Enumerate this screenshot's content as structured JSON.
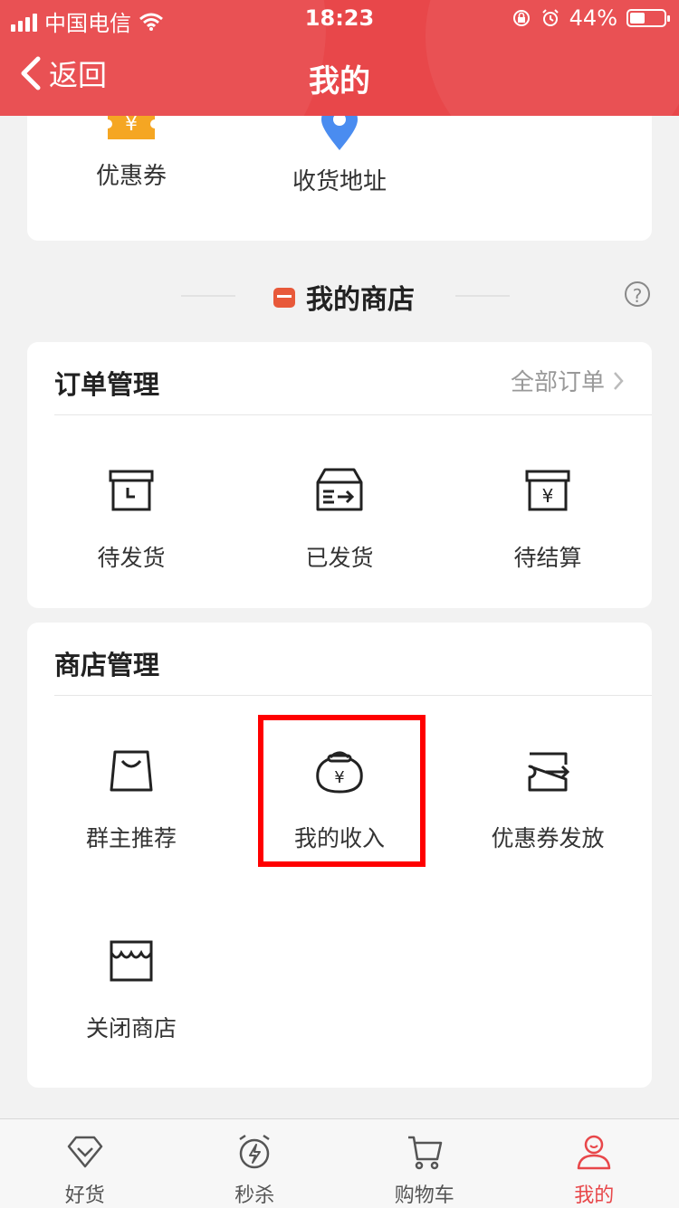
{
  "status": {
    "carrier": "中国电信",
    "time": "18:23",
    "battery": "44%"
  },
  "nav": {
    "back_label": "返回",
    "title": "我的"
  },
  "quick": [
    {
      "label": "优惠券",
      "icon": "coupon-icon"
    },
    {
      "label": "收货地址",
      "icon": "location-pin-icon"
    }
  ],
  "store_section": {
    "title": "我的商店"
  },
  "orders": {
    "title": "订单管理",
    "all_link": "全部订单",
    "items": [
      {
        "label": "待发货",
        "icon": "pending-ship-box-icon"
      },
      {
        "label": "已发货",
        "icon": "shipped-box-icon"
      },
      {
        "label": "待结算",
        "icon": "pending-settle-box-icon"
      }
    ]
  },
  "shop": {
    "title": "商店管理",
    "items": [
      {
        "label": "群主推荐",
        "icon": "shopping-bag-icon"
      },
      {
        "label": "我的收入",
        "icon": "money-bag-icon"
      },
      {
        "label": "优惠券发放",
        "icon": "coupon-send-icon"
      },
      {
        "label": "关闭商店",
        "icon": "storefront-icon"
      }
    ]
  },
  "tabs": [
    {
      "label": "好货",
      "icon": "diamond-icon",
      "active": false
    },
    {
      "label": "秒杀",
      "icon": "alarm-flash-icon",
      "active": false
    },
    {
      "label": "购物车",
      "icon": "cart-icon",
      "active": false
    },
    {
      "label": "我的",
      "icon": "user-icon",
      "active": true
    }
  ],
  "colors": {
    "accent": "#e8474a",
    "highlight": "#ff0000"
  }
}
